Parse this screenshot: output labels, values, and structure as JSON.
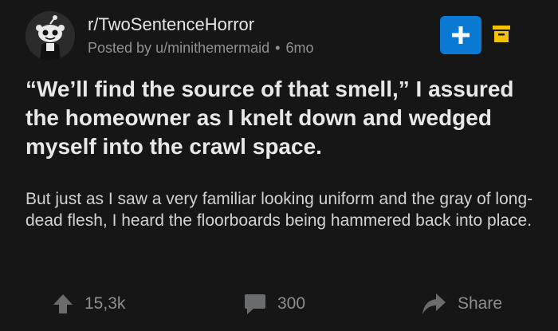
{
  "subreddit": {
    "name": "r/TwoSentenceHorror",
    "posted_by_prefix": "Posted by",
    "author": "u/minithemermaid",
    "separator": "•",
    "age": "6mo"
  },
  "icons": {
    "avatar": "subreddit-avatar-icon",
    "join": "plus-icon",
    "archive": "archive-icon",
    "upvote": "upvote-arrow-icon",
    "comment": "comment-bubble-icon",
    "share": "share-arrow-icon"
  },
  "colors": {
    "background": "#161616",
    "join_button": "#0a79d3",
    "archive": "#f5c000",
    "muted_text": "#8f9193"
  },
  "post": {
    "title": "“We’ll find the source of that smell,” I assured the homeowner as I knelt down and wedged myself into the crawl space.",
    "body": "But just as I saw a very familiar looking uniform and the gray of long-dead flesh, I heard the floorboards being hammered back into place."
  },
  "actions": {
    "upvotes": "15,3k",
    "comments": "300",
    "share_label": "Share"
  }
}
